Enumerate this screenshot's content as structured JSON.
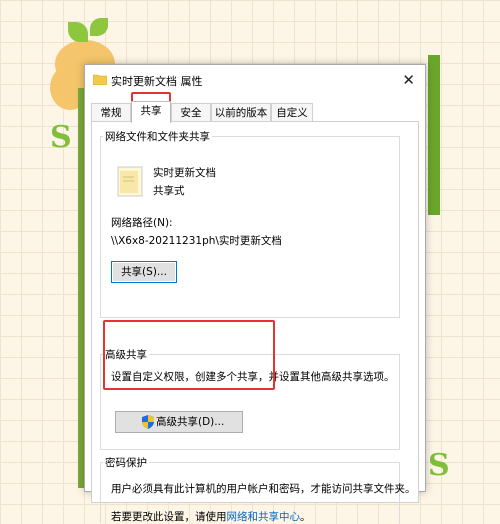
{
  "dialog": {
    "title": "实时更新文档 属性",
    "close_glyph": "✕",
    "tabs": [
      {
        "label": "常规"
      },
      {
        "label": "共享"
      },
      {
        "label": "安全"
      },
      {
        "label": "以前的版本"
      },
      {
        "label": "自定义"
      }
    ],
    "network_sharing": {
      "legend": "网络文件和文件夹共享",
      "item_name": "实时更新文档",
      "item_state": "共享式",
      "path_label": "网络路径(N):",
      "path_value": "\\\\X6x8-20211231ph\\实时更新文档",
      "share_button": "共享(S)..."
    },
    "advanced_sharing": {
      "legend": "高级共享",
      "description": "设置自定义权限，创建多个共享，并设置其他高级共享选项。",
      "button": "高级共享(D)..."
    },
    "password_protection": {
      "legend": "密码保护",
      "description": "用户必须具有此计算机的用户帐户和密码，才能访问共享文件夹。",
      "change_prefix": "若要更改此设置，请使用",
      "change_link": "网络和共享中心",
      "change_suffix": "。"
    }
  },
  "colors": {
    "highlight": "#e53333",
    "link": "#0066cc",
    "accent": "#0078d7"
  },
  "icons": [
    "folder-icon",
    "close-icon",
    "shield-icon"
  ]
}
